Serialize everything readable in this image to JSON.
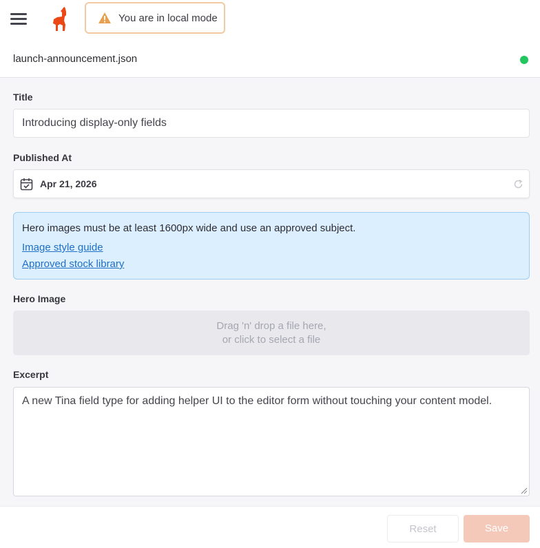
{
  "header": {
    "mode_message": "You are in local mode",
    "filename": "launch-announcement.json",
    "status_color": "#23c55e",
    "icons": [
      "hamburger-menu-icon",
      "llama-logo-icon",
      "warning-icon"
    ]
  },
  "form": {
    "title": {
      "label": "Title",
      "value": "Introducing display-only fields"
    },
    "published_at": {
      "label": "Published At",
      "value": "Apr 21, 2026"
    },
    "info": {
      "message": "Hero images must be at least 1600px wide and use an approved subject.",
      "links": [
        "Image style guide",
        "Approved stock library"
      ]
    },
    "hero_image": {
      "label": "Hero Image",
      "drop_line1": "Drag 'n' drop a file here,",
      "drop_line2": "or click to select a file"
    },
    "excerpt": {
      "label": "Excerpt",
      "value": "A new Tina field type for adding helper UI to the editor form without touching your content model."
    }
  },
  "footer": {
    "reset_label": "Reset",
    "save_label": "Save"
  },
  "colors": {
    "accent": "#ec4815",
    "info_bg": "#dcefff",
    "link": "#1f6fc6",
    "save_disabled": "#f4c9b9"
  }
}
